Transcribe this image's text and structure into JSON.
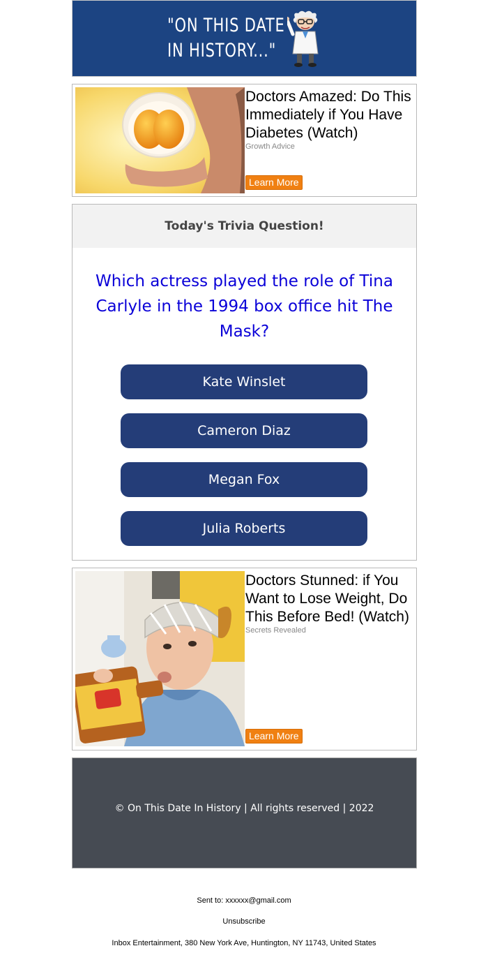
{
  "header": {
    "logo_text": "\"ON THIS DATE\nIN HISTORY...\"",
    "bg_color": "#1c4482"
  },
  "ad1": {
    "title": "Doctors Amazed: Do This Immediately if You Have Diabetes (Watch)",
    "source": "Growth Advice",
    "button": "Learn More"
  },
  "trivia": {
    "heading": "Today's Trivia Question!",
    "question": "Which actress played the role of Tina Carlyle in the 1994 box office hit The Mask?",
    "answers": [
      "Kate Winslet",
      "Cameron Diaz",
      "Megan Fox",
      "Julia Roberts"
    ],
    "question_color": "#0a00d8",
    "button_color": "#243d78"
  },
  "ad2": {
    "title": "Doctors Stunned: if You Want to Lose Weight, Do This Before Bed! (Watch)",
    "source": "Secrets Revealed",
    "button": "Learn More"
  },
  "footer": {
    "copyright": "© On This Date In History | All rights reserved | 2022"
  },
  "meta": {
    "sent_to": "Sent to: xxxxxx@gmail.com",
    "unsubscribe": "Unsubscribe",
    "address": "Inbox Entertainment, 380 New York Ave, Huntington, NY 11743, United States"
  }
}
